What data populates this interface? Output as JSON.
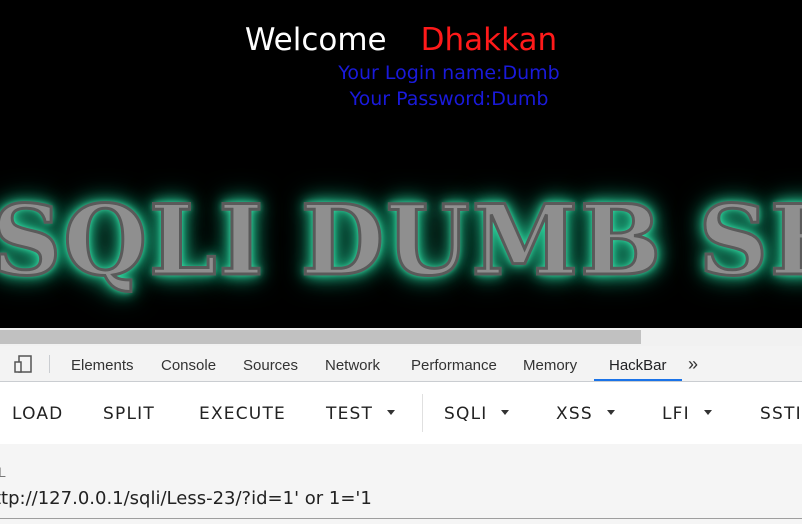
{
  "page": {
    "welcome": "Welcome",
    "name": "Dhakkan",
    "login_line": "Your Login name:Dumb",
    "password_line": "Your Password:Dumb",
    "banner": "SQLI DUMB SE"
  },
  "devtools": {
    "tabs": [
      {
        "label": "Elements"
      },
      {
        "label": "Console"
      },
      {
        "label": "Sources"
      },
      {
        "label": "Network"
      },
      {
        "label": "Performance"
      },
      {
        "label": "Memory"
      },
      {
        "label": "HackBar",
        "active": true
      }
    ],
    "more_icon": "»"
  },
  "hackbar": {
    "buttons": [
      {
        "label": "LOAD"
      },
      {
        "label": "SPLIT"
      },
      {
        "label": "EXECUTE"
      },
      {
        "label": "TEST",
        "dropdown": true
      },
      {
        "label": "SQLI",
        "dropdown": true
      },
      {
        "label": "XSS",
        "dropdown": true
      },
      {
        "label": "LFI",
        "dropdown": true
      },
      {
        "label": "SSTI"
      }
    ],
    "url_label": "RL",
    "url_value": "ttp://127.0.0.1/sqli/Less-23/?id=1' or 1='1"
  },
  "colors": {
    "welcome": "#ffffff",
    "name": "#ff1a1a",
    "credentials": "#1a1adb",
    "banner_glow": "#3fe8b0",
    "active_tab": "#1a73e8"
  }
}
